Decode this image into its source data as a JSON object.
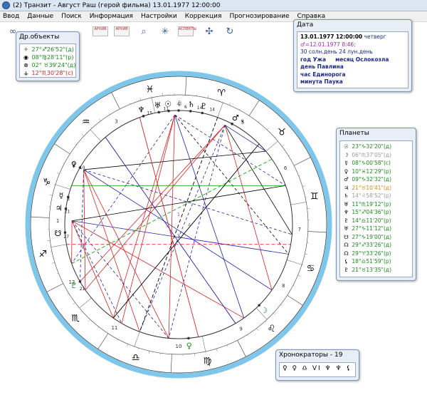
{
  "window": {
    "title": "(2) Транзит - Август Раш (герой фильма) 13.01.1977  12:00:00"
  },
  "menu": [
    "Ввод",
    "Данные",
    "Поиск",
    "Информация",
    "Настройки",
    "Коррекция",
    "Прогнозирование",
    "Справка"
  ],
  "toolbar": [
    {
      "name": "link-icon",
      "glyph": "∞"
    },
    {
      "name": "archive-left-button",
      "label": "АРХИВ"
    },
    {
      "name": "archive-right-button",
      "label": "АРХИВ"
    },
    {
      "name": "zoom-icon",
      "glyph": "⌕"
    },
    {
      "name": "aspects-chart-icon",
      "glyph": "✳"
    },
    {
      "name": "aspects-button",
      "label": "АСПЕКТЫ"
    },
    {
      "name": "aspect-lines-icon",
      "glyph": "✣"
    },
    {
      "name": "refresh-icon",
      "glyph": "↻"
    }
  ],
  "other_objects": {
    "title": "Др.объекты",
    "rows": [
      {
        "glyph": "✧",
        "text": "27°♐26'52\"(д)",
        "color": "#1a8a1a"
      },
      {
        "glyph": "◉",
        "text": "08°♍28'11\"(р)",
        "color": "#1a8a1a"
      },
      {
        "glyph": "⊗",
        "text": "02° ♉39'24\"(д)",
        "color": "#1a8a1a"
      },
      {
        "glyph": "⚶",
        "text": "12°♏30'28\"(с)",
        "color": "#d21f1f"
      }
    ]
  },
  "date_panel": {
    "title": "Дата",
    "date": "13.01.1977",
    "time": "12:00:00",
    "weekday": "четверг",
    "julian": "♂=12.01.1977",
    "julian_time": "8:46;",
    "solar_day": "30 солн.день",
    "lunar_day": "24 лун.день",
    "year": "год Ужа",
    "month": "месяц Ослокозла",
    "day": "день Павлина",
    "hour": "час Единорога",
    "minute": "минута Паука"
  },
  "planets_panel": {
    "title": "Планеты",
    "rows": [
      {
        "glyph": "☉",
        "text": "23°♑32'20\"(д)",
        "color": "#1a8a1a"
      },
      {
        "glyph": "☽",
        "text": "06°♏37'05\"(д)",
        "color": "#9a9a9a"
      },
      {
        "glyph": "☿",
        "text": "08°♑00'58\"(с)",
        "color": "#1a8a1a"
      },
      {
        "glyph": "♀",
        "text": "10°♓12'29\"(р)",
        "color": "#1a8a1a"
      },
      {
        "glyph": "♂",
        "text": "09°♑32'32\"(д)",
        "color": "#1a8a1a"
      },
      {
        "glyph": "♃",
        "text": "21°♉10'41\"(д)",
        "color": "#d88a1a"
      },
      {
        "glyph": "♄",
        "text": "14°♌58'52\"(р)",
        "color": "#9a9a9a"
      },
      {
        "glyph": "♅",
        "text": "11°♏19'12\"(р)",
        "color": "#1a8a1a"
      },
      {
        "glyph": "♆",
        "text": "15°♐04'36\"(р)",
        "color": "#1a8a1a"
      },
      {
        "glyph": "♇",
        "text": "14°♎11'20\"(р)",
        "color": "#1a8a1a"
      },
      {
        "glyph": "♅",
        "text": "27°♑11'12\"(д)",
        "color": "#1a8a1a"
      },
      {
        "glyph": "☋",
        "text": "27°♑19'00\"(д)",
        "color": "#1a8a1a"
      },
      {
        "glyph": "☊",
        "text": "29°♐33'26\"(д)",
        "color": "#1a8a1a"
      },
      {
        "glyph": "☊",
        "text": "29°♈33'26\"(р)",
        "color": "#1a8a1a"
      },
      {
        "glyph": "⚸",
        "text": "18°♎51'59\"(р)",
        "color": "#1a8a1a"
      },
      {
        "glyph": "♇",
        "text": "21°♉13'35\"(д)",
        "color": "#1a8a1a"
      }
    ]
  },
  "chrono_panel": {
    "title": "Хронократоры - 19",
    "values": [
      "♀",
      "♀",
      "♎",
      "VI",
      "♆",
      "♆",
      "⚸"
    ]
  },
  "chart": {
    "signs": [
      "♈",
      "♉",
      "♊",
      "♋",
      "♌",
      "♍",
      "♎",
      "♏",
      "♐",
      "♑",
      "♒",
      "♓"
    ],
    "house_numbers": [
      "1",
      "2",
      "3",
      "4",
      "5",
      "6",
      "7",
      "8",
      "9",
      "10",
      "11",
      "12"
    ],
    "center_house_labels": [
      "1",
      "2",
      "3",
      "4"
    ],
    "ring_color": "#7ec6ea",
    "planet_labels": [
      {
        "glyph": "♆",
        "num": "15",
        "color": "#000"
      },
      {
        "glyph": "♅",
        "num": "11",
        "color": "#000"
      },
      {
        "glyph": "☉",
        "num": "",
        "color": "#000"
      },
      {
        "glyph": "☽",
        "num": "6",
        "color": "#1a8a1a"
      },
      {
        "glyph": "♄",
        "num": "14",
        "color": "#000"
      },
      {
        "glyph": "♇",
        "num": "14",
        "color": "#000"
      },
      {
        "glyph": "♂",
        "num": "9",
        "color": "#000"
      },
      {
        "glyph": "♀",
        "num": "10",
        "color": "#000"
      },
      {
        "glyph": "☿",
        "num": "8",
        "color": "#000"
      },
      {
        "glyph": "♃",
        "num": "21",
        "color": "#000"
      },
      {
        "glyph": "☋",
        "num": "27",
        "color": "#000"
      },
      {
        "glyph": "♇",
        "num": "21",
        "color": "#1a8a1a"
      },
      {
        "glyph": "♀",
        "num": "",
        "color": "#1a8a1a"
      },
      {
        "glyph": "☽",
        "num": "",
        "color": "#1a8a1a"
      }
    ]
  }
}
